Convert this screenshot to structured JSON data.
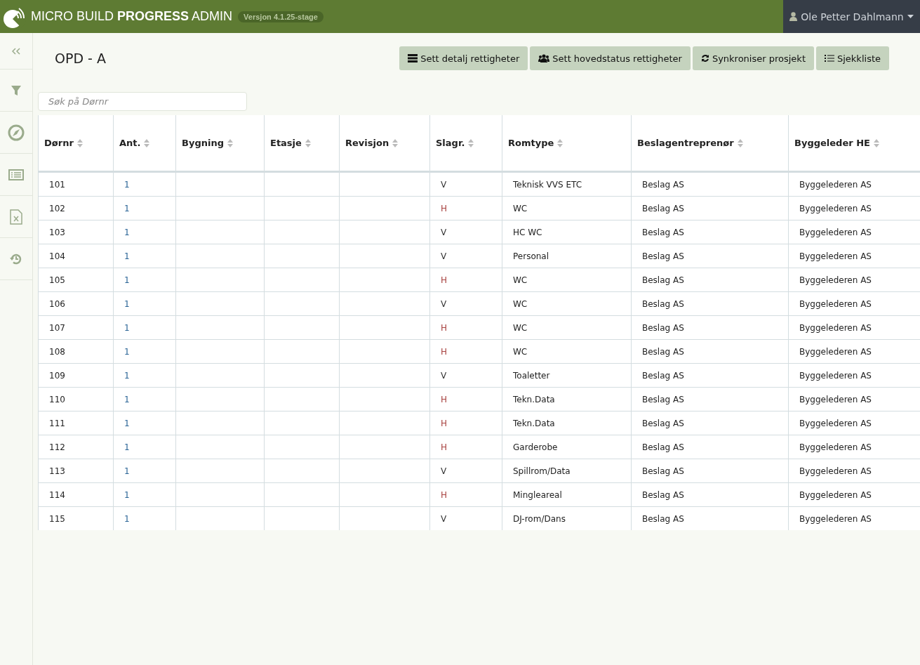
{
  "header": {
    "brand_light": "MICRO BUILD",
    "brand_bold": "PROGRESS",
    "brand_suffix": "ADMIN",
    "version": "Versjon 4.1.25-stage",
    "user": "Ole Petter Dahlmann"
  },
  "sidebar": {
    "items": [
      {
        "kind": "collapse"
      },
      {
        "kind": "filter"
      },
      {
        "kind": "compass"
      },
      {
        "kind": "list"
      },
      {
        "kind": "excel"
      },
      {
        "kind": "history"
      }
    ]
  },
  "page": {
    "title": "OPD - A"
  },
  "actions": [
    {
      "kind": "server",
      "label": "Sett detalj rettigheter"
    },
    {
      "kind": "users",
      "label": "Sett hovedstatus rettigheter"
    },
    {
      "kind": "refresh",
      "label": "Synkroniser prosjekt"
    },
    {
      "kind": "checklist",
      "label": "Sjekkliste"
    }
  ],
  "search": {
    "placeholder": "Søk på Dørnr"
  },
  "table": {
    "columns": [
      "Dørnr",
      "Ant.",
      "Bygning",
      "Etasje",
      "Revisjon",
      "Slagr.",
      "Romtype",
      "Beslagentreprenør",
      "Byggeleder HE"
    ],
    "rows": [
      {
        "dornr": "101",
        "ant": "1",
        "slagr": {
          "text": "V",
          "color": "#333333"
        },
        "romtype": "Teknisk VVS ETC",
        "beslag": "Beslag AS",
        "byggeleder": "Byggelederen AS"
      },
      {
        "dornr": "102",
        "ant": "1",
        "slagr": {
          "text": "H",
          "color": "#a94442"
        },
        "romtype": "WC",
        "beslag": "Beslag AS",
        "byggeleder": "Byggelederen AS"
      },
      {
        "dornr": "103",
        "ant": "1",
        "slagr": {
          "text": "V",
          "color": "#333333"
        },
        "romtype": "HC WC",
        "beslag": "Beslag AS",
        "byggeleder": "Byggelederen AS"
      },
      {
        "dornr": "104",
        "ant": "1",
        "slagr": {
          "text": "V",
          "color": "#333333"
        },
        "romtype": "Personal",
        "beslag": "Beslag AS",
        "byggeleder": "Byggelederen AS"
      },
      {
        "dornr": "105",
        "ant": "1",
        "slagr": {
          "text": "H",
          "color": "#a94442"
        },
        "romtype": "WC",
        "beslag": "Beslag AS",
        "byggeleder": "Byggelederen AS"
      },
      {
        "dornr": "106",
        "ant": "1",
        "slagr": {
          "text": "V",
          "color": "#333333"
        },
        "romtype": "WC",
        "beslag": "Beslag AS",
        "byggeleder": "Byggelederen AS"
      },
      {
        "dornr": "107",
        "ant": "1",
        "slagr": {
          "text": "H",
          "color": "#a94442"
        },
        "romtype": "WC",
        "beslag": "Beslag AS",
        "byggeleder": "Byggelederen AS"
      },
      {
        "dornr": "108",
        "ant": "1",
        "slagr": {
          "text": "H",
          "color": "#a94442"
        },
        "romtype": "WC",
        "beslag": "Beslag AS",
        "byggeleder": "Byggelederen AS"
      },
      {
        "dornr": "109",
        "ant": "1",
        "slagr": {
          "text": "V",
          "color": "#333333"
        },
        "romtype": "Toaletter",
        "beslag": "Beslag AS",
        "byggeleder": "Byggelederen AS"
      },
      {
        "dornr": "110",
        "ant": "1",
        "slagr": {
          "text": "H",
          "color": "#a94442"
        },
        "romtype": "Tekn.Data",
        "beslag": "Beslag AS",
        "byggeleder": "Byggelederen AS"
      },
      {
        "dornr": "111",
        "ant": "1",
        "slagr": {
          "text": "H",
          "color": "#a94442"
        },
        "romtype": "Tekn.Data",
        "beslag": "Beslag AS",
        "byggeleder": "Byggelederen AS"
      },
      {
        "dornr": "112",
        "ant": "1",
        "slagr": {
          "text": "H",
          "color": "#a94442"
        },
        "romtype": "Garderobe",
        "beslag": "Beslag AS",
        "byggeleder": "Byggelederen AS"
      },
      {
        "dornr": "113",
        "ant": "1",
        "slagr": {
          "text": "V",
          "color": "#333333"
        },
        "romtype": "Spillrom/Data",
        "beslag": "Beslag AS",
        "byggeleder": "Byggelederen AS"
      },
      {
        "dornr": "114",
        "ant": "1",
        "slagr": {
          "text": "H",
          "color": "#a94442"
        },
        "romtype": "Mingleareal",
        "beslag": "Beslag AS",
        "byggeleder": "Byggelederen AS"
      },
      {
        "dornr": "115",
        "ant": "1",
        "slagr": {
          "text": "V",
          "color": "#333333"
        },
        "romtype": "DJ-rom/Dans",
        "beslag": "Beslag AS",
        "byggeleder": "Byggelederen AS"
      }
    ]
  }
}
